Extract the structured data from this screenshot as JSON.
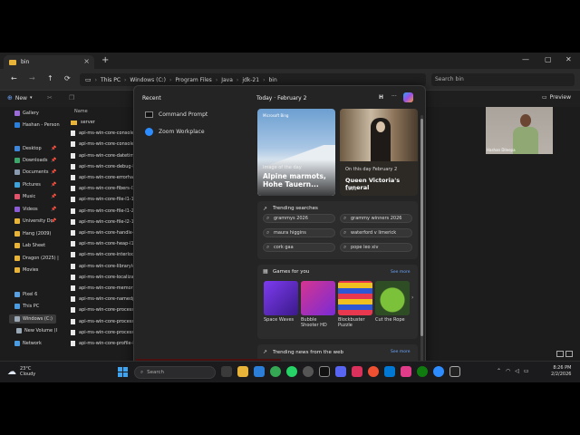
{
  "explorer": {
    "tab_title": "bin",
    "breadcrumbs": [
      "This PC",
      "Windows (C:)",
      "Program Files",
      "Java",
      "jdk-21",
      "bin"
    ],
    "search_placeholder": "Search bin",
    "new_label": "New",
    "preview_label": "Preview",
    "column_name": "Name"
  },
  "sidebar": {
    "items": [
      {
        "label": "Gallery",
        "icon": "gallery-icon",
        "color": "#9b6bd6"
      },
      {
        "label": "Hashan - Person",
        "icon": "onedrive-icon",
        "color": "#2b7fd8"
      },
      {
        "label": "Desktop",
        "icon": "desktop-icon",
        "color": "#3f86d8"
      },
      {
        "label": "Downloads",
        "icon": "downloads-icon",
        "color": "#3fa66b"
      },
      {
        "label": "Documents",
        "icon": "documents-icon",
        "color": "#8a9bb0"
      },
      {
        "label": "Pictures",
        "icon": "pictures-icon",
        "color": "#3fa2d8"
      },
      {
        "label": "Music",
        "icon": "music-icon",
        "color": "#e0536b"
      },
      {
        "label": "Videos",
        "icon": "videos-icon",
        "color": "#8b5cd6"
      },
      {
        "label": "University Do",
        "icon": "folder-icon",
        "color": "#e8b339"
      },
      {
        "label": "Hang (2009)",
        "icon": "folder-icon",
        "color": "#e8b339"
      },
      {
        "label": "Lab Sheet",
        "icon": "folder-icon",
        "color": "#e8b339"
      },
      {
        "label": "Dragon (2025) |",
        "icon": "folder-icon",
        "color": "#e8b339"
      },
      {
        "label": "Movies",
        "icon": "folder-icon",
        "color": "#e8b339"
      },
      {
        "label": "Pixel 6",
        "icon": "phone-icon",
        "color": "#5aa0e0"
      },
      {
        "label": "This PC",
        "icon": "pc-icon",
        "color": "#4a9be0"
      },
      {
        "label": "Windows (C:)",
        "icon": "drive-icon",
        "color": "#9aa7b5"
      },
      {
        "label": "New Volume (I",
        "icon": "drive-icon",
        "color": "#9aa7b5"
      },
      {
        "label": "Network",
        "icon": "network-icon",
        "color": "#4a9be0"
      }
    ]
  },
  "files": [
    {
      "name": "server",
      "type": "folder"
    },
    {
      "name": "api-ms-win-core-console-l1",
      "type": "file"
    },
    {
      "name": "api-ms-win-core-console-l1",
      "type": "file"
    },
    {
      "name": "api-ms-win-core-datetime-",
      "type": "file"
    },
    {
      "name": "api-ms-win-core-debug-l1-",
      "type": "file"
    },
    {
      "name": "api-ms-win-core-errorhandl",
      "type": "file"
    },
    {
      "name": "api-ms-win-core-fibers-l1-",
      "type": "file"
    },
    {
      "name": "api-ms-win-core-file-l1-1-",
      "type": "file"
    },
    {
      "name": "api-ms-win-core-file-l1-2-",
      "type": "file"
    },
    {
      "name": "api-ms-win-core-file-l2-1-",
      "type": "file"
    },
    {
      "name": "api-ms-win-core-handle-l1-",
      "type": "file"
    },
    {
      "name": "api-ms-win-core-heap-l1-1",
      "type": "file"
    },
    {
      "name": "api-ms-win-core-interlocke",
      "type": "file"
    },
    {
      "name": "api-ms-win-core-libraryloa",
      "type": "file"
    },
    {
      "name": "api-ms-win-core-localizatio",
      "type": "file"
    },
    {
      "name": "api-ms-win-core-memory-l",
      "type": "file"
    },
    {
      "name": "api-ms-win-core-namedpip",
      "type": "file"
    },
    {
      "name": "api-ms-win-core-processen",
      "type": "file"
    },
    {
      "name": "api-ms-win-core-processth",
      "type": "file"
    },
    {
      "name": "api-ms-win-core-processth",
      "type": "file"
    },
    {
      "name": "api-ms-win-core-profile-l1",
      "type": "file"
    }
  ],
  "flyout": {
    "recent_title": "Recent",
    "recent_items": [
      "Command Prompt",
      "Zoom Workplace"
    ],
    "today_label": "Today · February 2",
    "h_label": "H",
    "more_label": "···",
    "image_card": {
      "brand": "Microsoft Bing",
      "label": "Image of the day",
      "title": "Alpine marmots, Hohe Tauern..."
    },
    "history_card": {
      "label": "On this day February 2",
      "title": "Queen Victoria's funeral",
      "year": "1901"
    },
    "trending_title": "Trending searches",
    "trending": [
      "grammys 2026",
      "grammy winners 2026",
      "maura higgins",
      "waterford v limerick",
      "cork gaa",
      "pope leo xiv"
    ],
    "games_title": "Games for you",
    "see_more": "See more",
    "games": [
      {
        "name": "Space Waves",
        "color": "#6b2bd6"
      },
      {
        "name": "Bubble Shooter HD",
        "color": "#b8329a"
      },
      {
        "name": "Blockbuster Puzzle",
        "color": "#2a3fa8"
      },
      {
        "name": "Cut the Rope",
        "color": "#3a6b2a"
      }
    ],
    "news_title": "Trending news from the web"
  },
  "webcam": {
    "name": "Hashan Dileepa"
  },
  "taskbar": {
    "temperature": "23°C",
    "condition": "Cloudy",
    "search_placeholder": "Search",
    "time": "8:26 PM",
    "date": "2/2/2026"
  }
}
